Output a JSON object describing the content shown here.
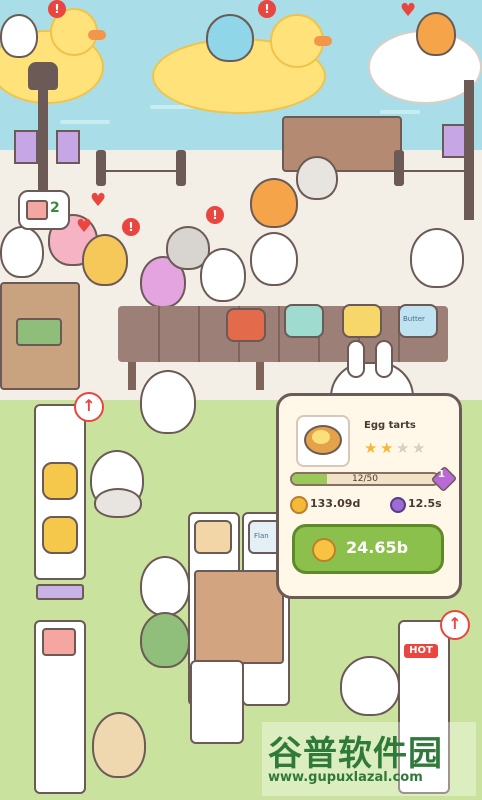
{
  "hud": {
    "quest_count": "2",
    "alerts": [
      "!",
      "!",
      "!",
      "!",
      "!",
      "!"
    ]
  },
  "popup": {
    "item_name": "Egg tarts",
    "stars_filled": 2,
    "stars_total": 4,
    "progress_text": "12/50",
    "progress_fraction": 0.24,
    "gem_level": "1",
    "income_value": "133.09d",
    "time_value": "12.5s",
    "upgrade_cost": "24.65b"
  },
  "decor": {
    "hot_sign": "HOT",
    "cake_jar_label": "Flan",
    "cookie_tin_label": "Butter"
  },
  "watermark": {
    "title": "谷普软件园",
    "url": "www.gupuxlazal.com"
  },
  "colors": {
    "pond": "#a9dde7",
    "grass": "#c9e39e",
    "buy_button": "#8cc04d",
    "alert_red": "#e8463e",
    "outline": "#6b5a55"
  },
  "icons": [
    "coin-icon",
    "timer-icon",
    "gem-icon",
    "star-icon",
    "paw-coin-icon",
    "up-arrow-icon",
    "alert-icon",
    "heart-icon"
  ]
}
